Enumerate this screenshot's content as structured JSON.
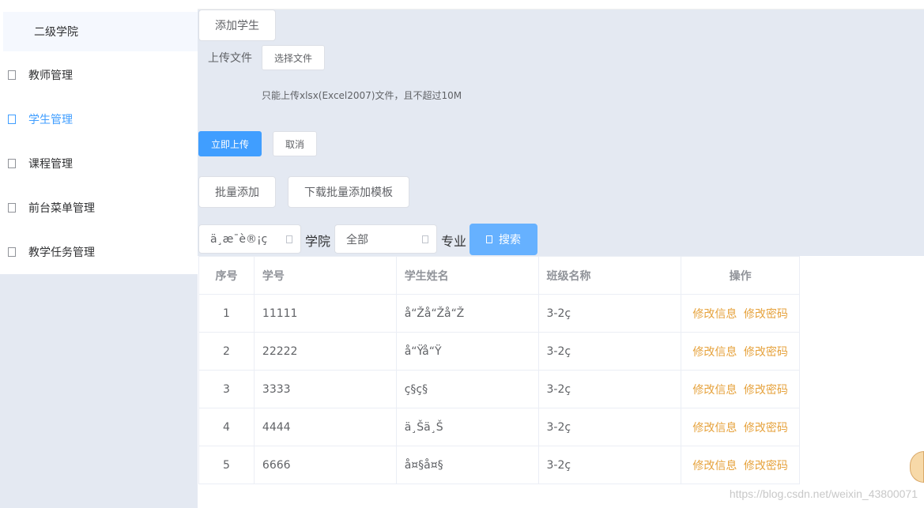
{
  "sidebar": {
    "subtitle": "二级学院",
    "items": [
      {
        "label": "教师管理"
      },
      {
        "label": "学生管理"
      },
      {
        "label": "课程管理"
      },
      {
        "label": "前台菜单管理"
      },
      {
        "label": "教学任务管理"
      }
    ],
    "active_index": 1,
    "active_color": "#409eff"
  },
  "toolbar": {
    "add_student": "添加学生",
    "upload_label": "上传文件",
    "choose_file": "选择文件",
    "upload_tip": "只能上传xlsx(Excel2007)文件，且不超过10M",
    "upload_now": "立即上传",
    "cancel": "取消",
    "batch_add": "批量添加",
    "download_template": "下载批量添加模板"
  },
  "filters": {
    "college_select_value": "ä¸æ¯è®¡ç",
    "college_label": "学院",
    "major_select_value": "全部",
    "major_label": "专业",
    "search_button": "搜索"
  },
  "table": {
    "columns": [
      "序号",
      "学号",
      "学生姓名",
      "班级名称",
      "操作"
    ],
    "rows": [
      {
        "idx": "1",
        "id": "11111",
        "name": "å“Žå“Žå“Ž",
        "class": "3-2ç"
      },
      {
        "idx": "2",
        "id": "22222",
        "name": "å“Ÿå“Ÿ",
        "class": "3-2ç"
      },
      {
        "idx": "3",
        "id": "3333",
        "name": "ç§ç§",
        "class": "3-2ç"
      },
      {
        "idx": "4",
        "id": "4444",
        "name": "ä¸Šä¸Š",
        "class": "3-2ç"
      },
      {
        "idx": "5",
        "id": "6666",
        "name": "å¤§å¤§",
        "class": "3-2ç"
      }
    ],
    "edit_info": "修改信息",
    "edit_password": "修改密码",
    "link_color": "#e6a23c"
  },
  "watermark": "https://blog.csdn.net/weixin_43800071"
}
